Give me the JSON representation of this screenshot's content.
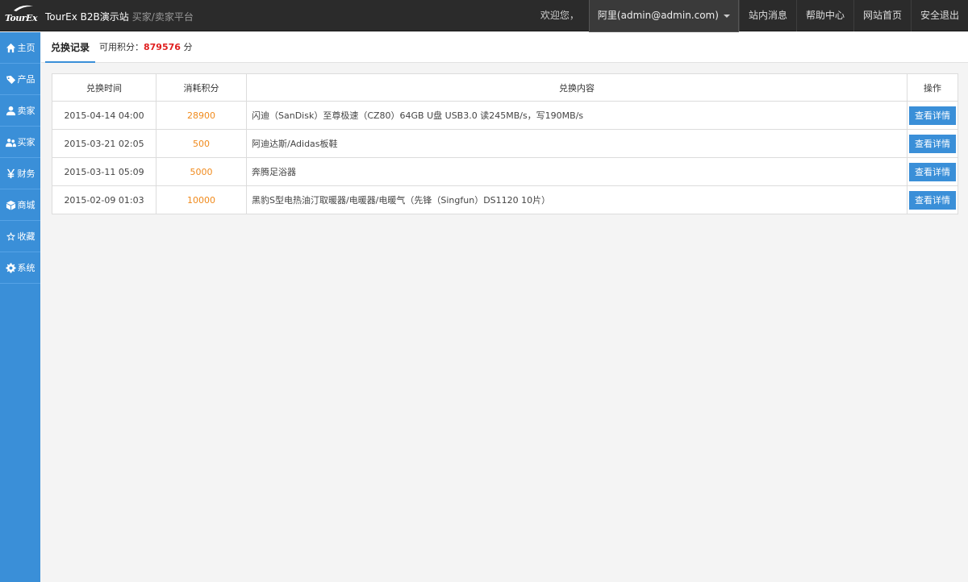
{
  "header": {
    "logo_text": "TourEx",
    "site_title": "TourEx B2B演示站",
    "site_subtitle": "买家/卖家平台",
    "welcome": "欢迎您，",
    "user": "阿里(admin@admin.com)",
    "links": [
      "站内消息",
      "帮助中心",
      "网站首页",
      "安全退出"
    ]
  },
  "sidebar": {
    "items": [
      {
        "label": "主页",
        "icon": "home-icon"
      },
      {
        "label": "产品",
        "icon": "tag-icon"
      },
      {
        "label": "卖家",
        "icon": "user-icon"
      },
      {
        "label": "买家",
        "icon": "users-icon"
      },
      {
        "label": "财务",
        "icon": "yen-icon"
      },
      {
        "label": "商城",
        "icon": "cube-icon"
      },
      {
        "label": "收藏",
        "icon": "star-icon"
      },
      {
        "label": "系统",
        "icon": "gear-icon"
      }
    ]
  },
  "tabs": {
    "active": "兑换记录",
    "points_label": "可用积分：",
    "points_value": "879576",
    "points_unit": "分"
  },
  "table": {
    "headers": [
      "兑换时间",
      "消耗积分",
      "兑换内容",
      "操作"
    ],
    "rows": [
      {
        "time": "2015-04-14 04:00",
        "cost": "28900",
        "content": "闪迪（SanDisk）至尊极速（CZ80）64GB U盘 USB3.0 读245MB/s，写190MB/s",
        "action": "查看详情"
      },
      {
        "time": "2015-03-21 02:05",
        "cost": "500",
        "content": "阿迪达斯/Adidas板鞋",
        "action": "查看详情"
      },
      {
        "time": "2015-03-11 05:09",
        "cost": "5000",
        "content": "奔腾足浴器",
        "action": "查看详情"
      },
      {
        "time": "2015-02-09 01:03",
        "cost": "10000",
        "content": "黑豹S型电热油汀取暖器/电暖器/电暖气（先锋（Singfun）DS1120 10片）",
        "action": "查看详情"
      }
    ]
  },
  "colors": {
    "accent": "#3a8fd8",
    "points": "#e02020",
    "cost": "#f08a1c",
    "topbar": "#2b2b2b"
  }
}
